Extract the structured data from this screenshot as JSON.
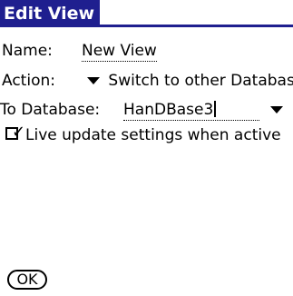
{
  "title": "Edit View",
  "fields": {
    "name": {
      "label": "Name:",
      "value": "New View"
    },
    "action": {
      "label": "Action:",
      "value": "Switch to other Database"
    },
    "to_database": {
      "label": "To Database:",
      "value": "HanDBase3"
    }
  },
  "live_update": {
    "label": "Live update settings when active",
    "checked": true
  },
  "buttons": {
    "ok": "OK"
  },
  "icons": {
    "dropdown": "triangle-down-icon",
    "checkbox": "checkbox-checked-icon"
  },
  "colors": {
    "title_background": "#1f1f8f",
    "title_text": "#ffffff",
    "background": "#ffffff",
    "text": "#000000"
  }
}
